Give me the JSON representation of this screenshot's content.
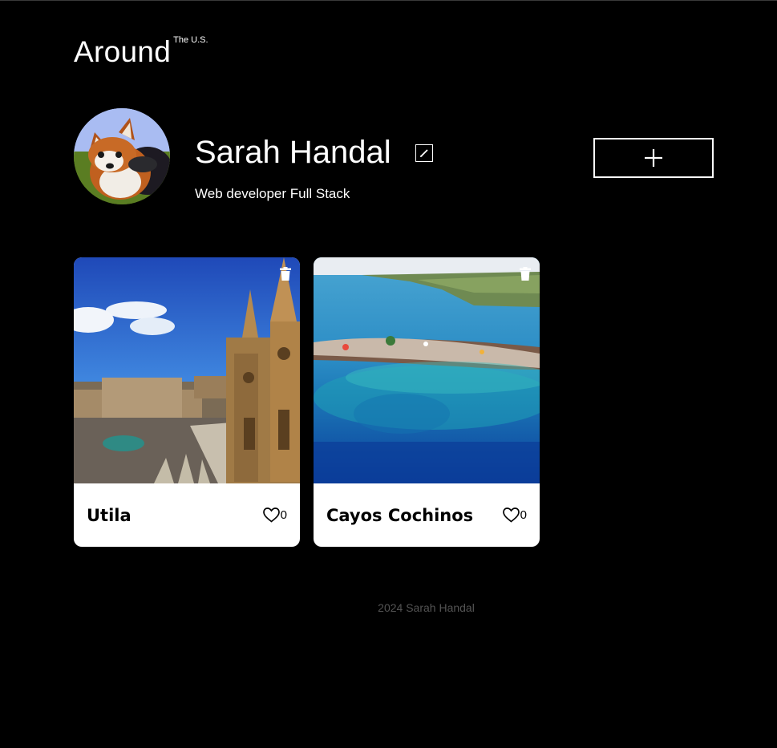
{
  "header": {
    "logo_main": "Around",
    "logo_sup": "The U.S."
  },
  "profile": {
    "name": "Sarah Handal",
    "about": "Web developer Full Stack",
    "edit_icon": "pencil-icon",
    "add_icon": "plus-icon"
  },
  "cards": [
    {
      "title": "Utila",
      "likes": "0",
      "image": "cathedral-plaza-photo",
      "delete_icon": "trash-icon",
      "like_icon": "heart-icon"
    },
    {
      "title": "Cayos Cochinos",
      "likes": "0",
      "image": "island-reef-aerial-photo",
      "delete_icon": "trash-icon",
      "like_icon": "heart-icon"
    }
  ],
  "footer": {
    "copyright": "2024 Sarah Handal"
  },
  "colors": {
    "background": "#000000",
    "card": "#ffffff",
    "footer_text": "#545454"
  }
}
